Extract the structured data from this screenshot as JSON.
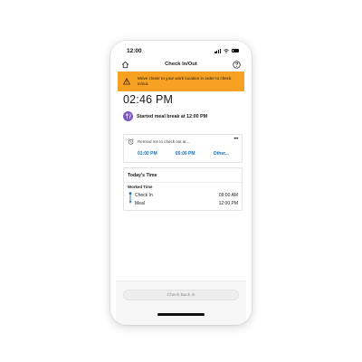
{
  "status_bar": {
    "time": "12:00"
  },
  "header": {
    "title": "Check In/Out",
    "home_icon": "home-icon",
    "help_icon": "help-icon"
  },
  "banner": {
    "text": "Move closer to your work location in order to check in/out.",
    "color": "#f7a123",
    "icon": "warning-icon"
  },
  "current_time": "02:46 PM",
  "event": {
    "text": "Started meal break at 12:00 PM",
    "icon": "meal-icon",
    "color": "#7b57bd"
  },
  "reminder": {
    "label": "Remind me to check out at...",
    "options": [
      "01:00 PM",
      "05:00 PM",
      "Other..."
    ],
    "more": "•••",
    "accent": "#1b6fb5"
  },
  "todays_time": {
    "title": "Today's Time",
    "section_label": "Worked Time",
    "entries": [
      {
        "label": "Check In",
        "time": "09:00 AM"
      },
      {
        "label": "Meal",
        "time": "12:00 PM"
      }
    ],
    "timeline_color": "#1b6fb5"
  },
  "footer": {
    "button_label": "Check Back In"
  }
}
